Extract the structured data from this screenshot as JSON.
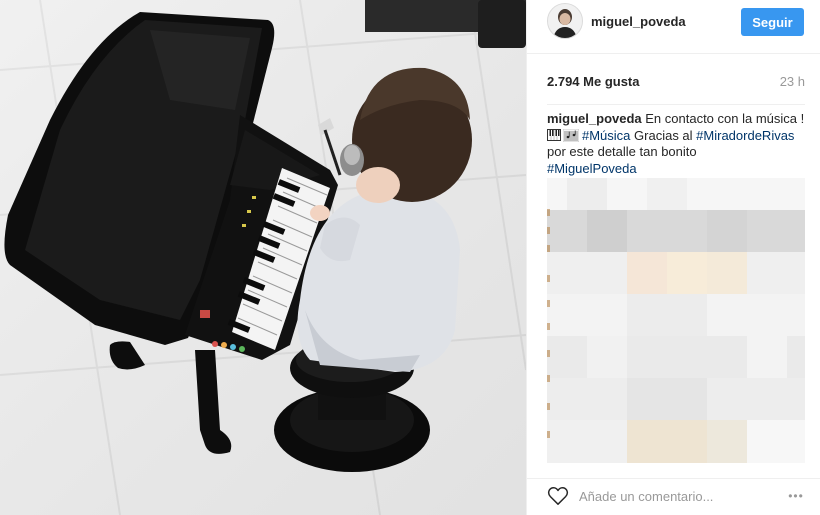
{
  "post": {
    "username": "miguel_poveda",
    "follow_label": "Seguir",
    "likes": "2.794 Me gusta",
    "time_ago": "23 h",
    "caption": {
      "user": "miguel_poveda",
      "text_1": " En contacto con la música !",
      "hashtag_1": "#Música",
      "text_2": " Gracias al ",
      "hashtag_2": "#MiradordeRivas",
      "text_3": " por este detalle tan bonito",
      "hashtag_3": "#MiguelPoveda"
    },
    "emoji": [
      "piano-icon",
      "musical-score-icon"
    ]
  },
  "comment_box": {
    "placeholder": "Añade un comentario..."
  },
  "more_label": "•••",
  "colors": {
    "accent": "#3897f0",
    "hashtag": "#003569",
    "muted": "#999999"
  }
}
